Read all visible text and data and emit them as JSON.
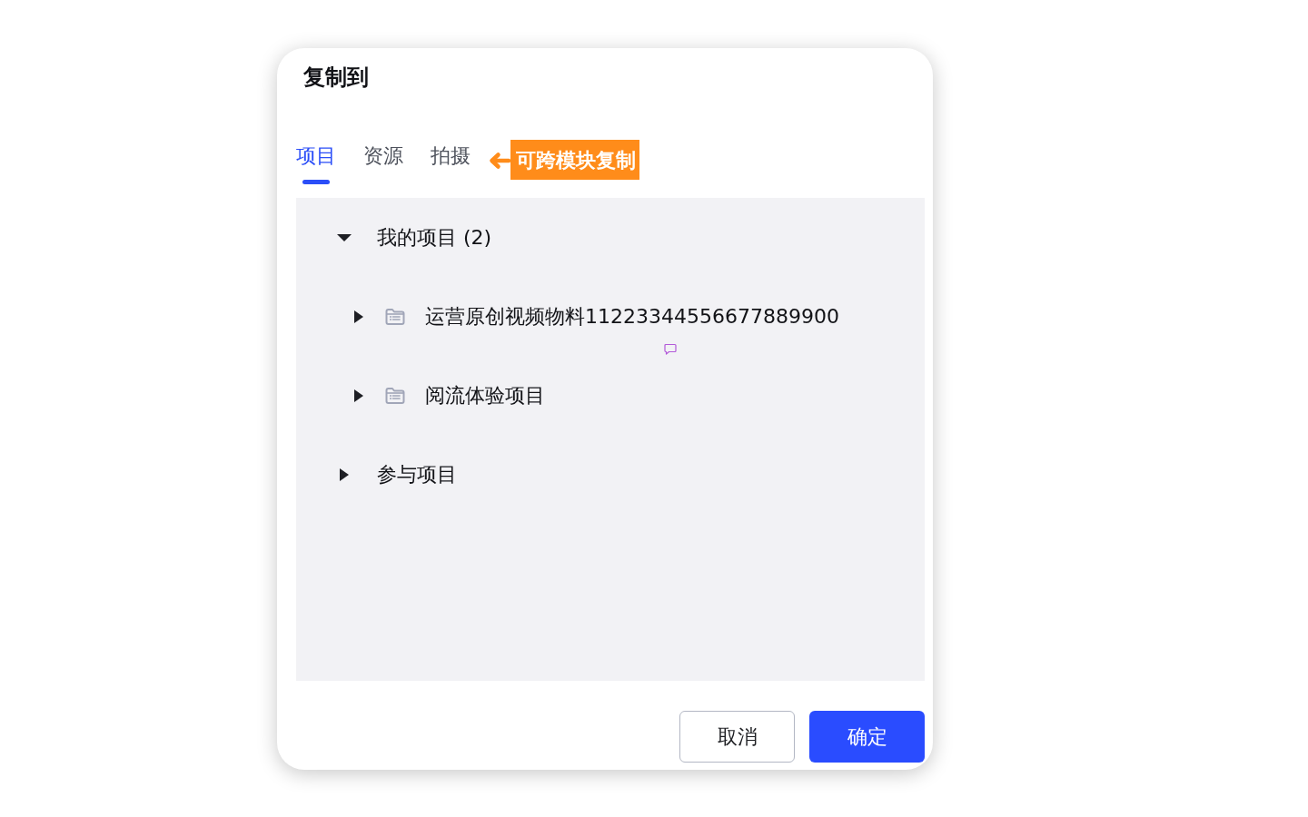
{
  "dialog": {
    "title": "复制到"
  },
  "tabs": [
    {
      "label": "项目",
      "selected": true
    },
    {
      "label": "资源",
      "selected": false
    },
    {
      "label": "拍摄",
      "selected": false
    }
  ],
  "annotation": {
    "text": "可跨模块复制"
  },
  "tree": [
    {
      "label": "我的项目 (2)",
      "expanded": true,
      "children": [
        {
          "label": "运营原创视频物料11223344556677889900",
          "expanded": false
        },
        {
          "label": "阅流体验项目",
          "expanded": false
        }
      ]
    },
    {
      "label": "参与项目",
      "expanded": false
    }
  ],
  "buttons": [
    {
      "label": "取消",
      "kind": "secondary"
    },
    {
      "label": "确定",
      "kind": "primary"
    }
  ]
}
